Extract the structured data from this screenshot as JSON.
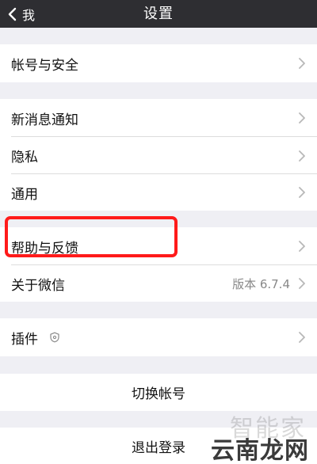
{
  "nav": {
    "back_label": "我",
    "title": "设置"
  },
  "rows": {
    "account_security": "帐号与安全",
    "new_message_notice": "新消息通知",
    "privacy": "隐私",
    "general": "通用",
    "help_feedback": "帮助与反馈",
    "about_wechat": "关于微信",
    "about_version": "版本 6.7.4",
    "plugins": "插件",
    "switch_account": "切换帐号",
    "logout": "退出登录"
  },
  "icons": {
    "back": "chevron-left-icon",
    "disclosure": "chevron-right-icon",
    "plugin": "plugin-badge-icon"
  },
  "colors": {
    "navbar": "#2e2e32",
    "background": "#efeff4",
    "highlight": "#ff1a1a"
  },
  "watermark": {
    "line1": "智能家",
    "line2": "云南龙网"
  }
}
